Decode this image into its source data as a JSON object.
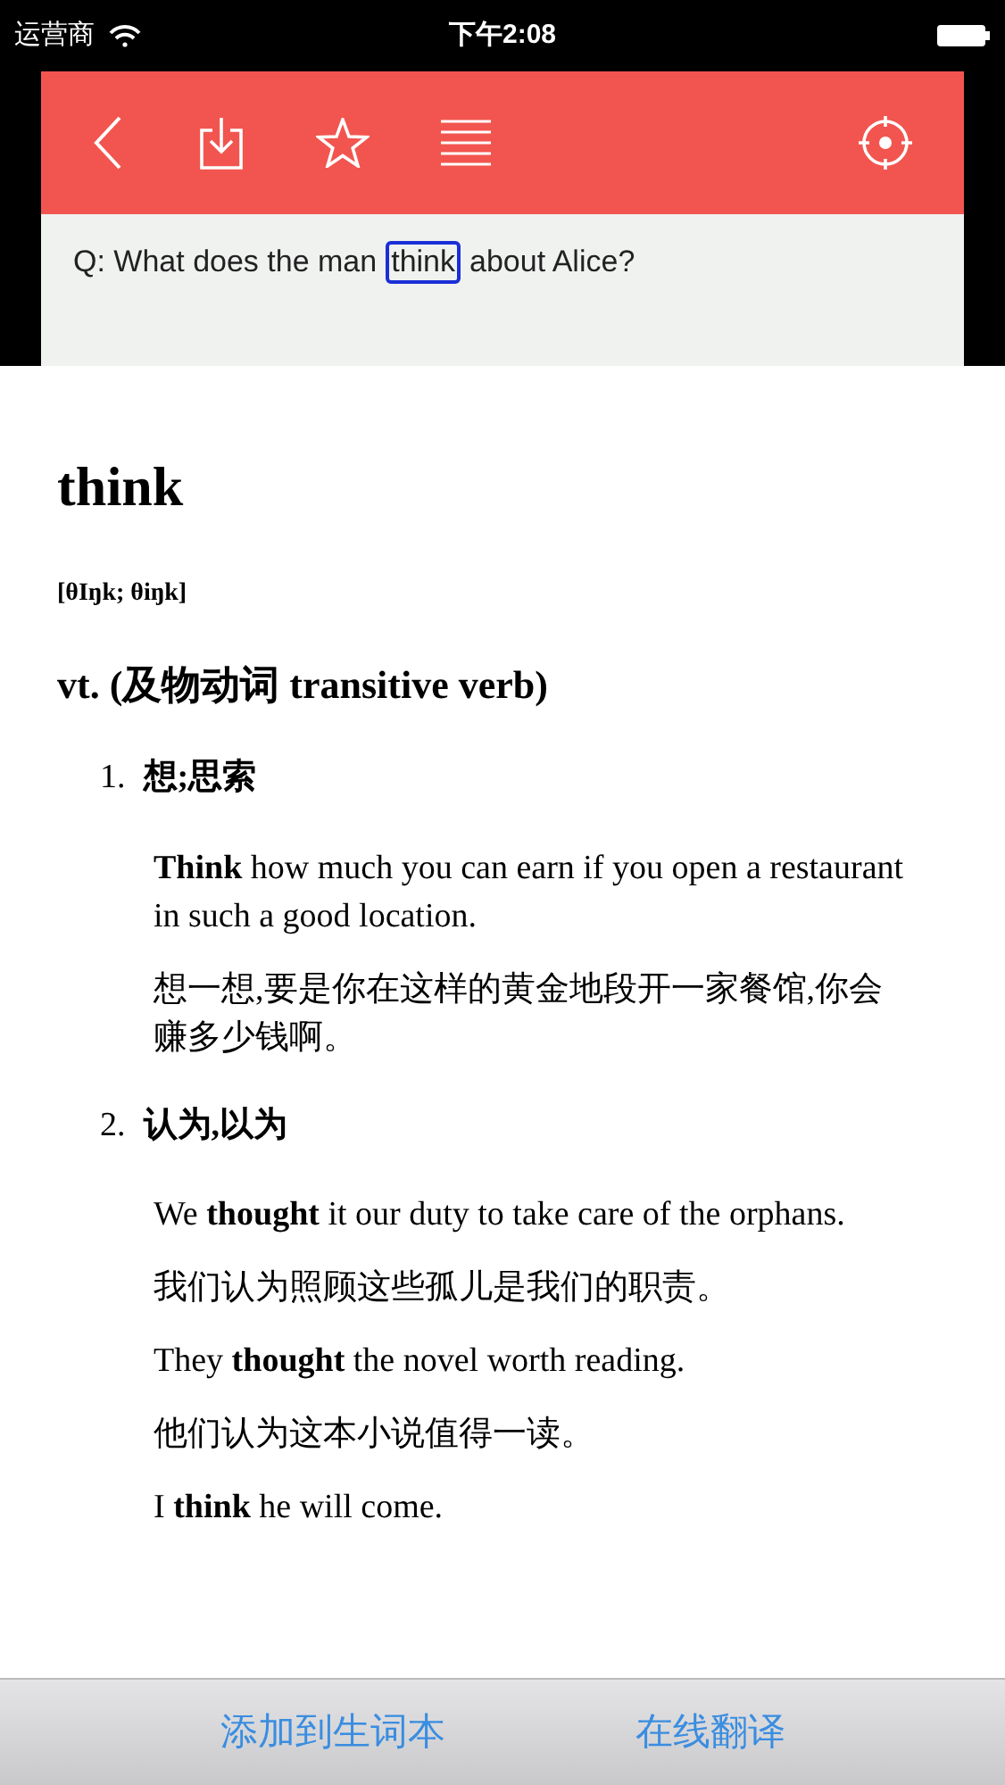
{
  "status_bar": {
    "carrier": "运营商",
    "time": "下午2:08"
  },
  "question": {
    "before": "Q: What does the man",
    "highlighted": "think",
    "after": "about Alice?"
  },
  "entry": {
    "word": "think",
    "phonetic": "[θIŋk; θiŋk]",
    "part_of_speech": "vt. (及物动词 transitive verb)",
    "senses": [
      {
        "number": "1.",
        "meaning": "想;思索",
        "examples": [
          "**Think** how much you can earn if you open a restaurant in such a good location.",
          "想一想,要是你在这样的黄金地段开一家餐馆,你会赚多少钱啊。"
        ]
      },
      {
        "number": "2.",
        "meaning": "认为,以为",
        "examples": [
          "We **thought** it our duty to take care of the orphans.",
          "我们认为照顾这些孤儿是我们的职责。",
          "They **thought** the novel worth reading.",
          "他们认为这本小说值得一读。",
          "I **think** he will come."
        ]
      }
    ]
  },
  "bottom_actions": [
    "添加到生词本",
    "在线翻译"
  ]
}
